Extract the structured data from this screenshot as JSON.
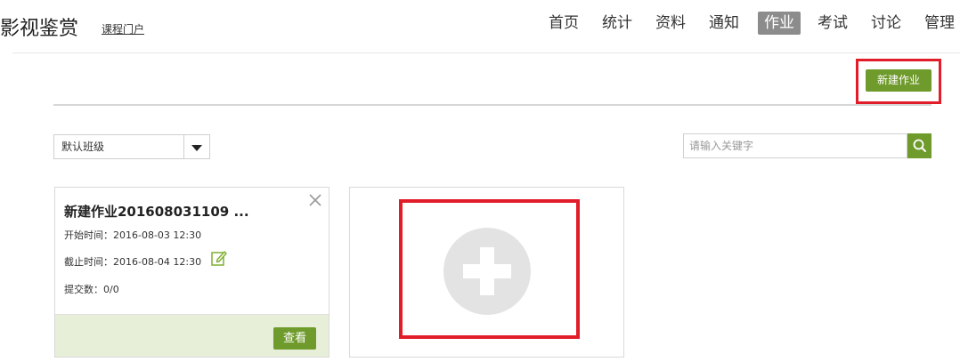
{
  "header": {
    "course_title": "影视鉴赏",
    "portal_link": "课程门户",
    "nav": [
      {
        "label": "首页"
      },
      {
        "label": "统计"
      },
      {
        "label": "资料"
      },
      {
        "label": "通知"
      },
      {
        "label": "作业",
        "active": true
      },
      {
        "label": "考试"
      },
      {
        "label": "讨论"
      },
      {
        "label": "管理"
      }
    ]
  },
  "toolbar": {
    "new_homework_label": "新建作业"
  },
  "filters": {
    "class_select_value": "默认班级",
    "search_placeholder": "请输入关键字"
  },
  "homework_cards": [
    {
      "title": "新建作业201608031109 ...",
      "start_label": "开始时间：",
      "start_time": "2016-08-03 12:30",
      "end_label": "截止时间：",
      "end_time": "2016-08-04 12:30",
      "submit_label": "提交数：",
      "submit_count": "0/0",
      "view_label": "查看"
    }
  ],
  "colors": {
    "accent_green": "#6f9a2c",
    "highlight_red": "#e11d2a",
    "nav_active_bg": "#8c8c8c",
    "card_footer_bg": "#e8efd9"
  },
  "icons": {
    "search": "search-icon",
    "close": "close-icon",
    "edit": "edit-icon",
    "add": "add-icon",
    "dropdown": "chevron-down-icon"
  }
}
